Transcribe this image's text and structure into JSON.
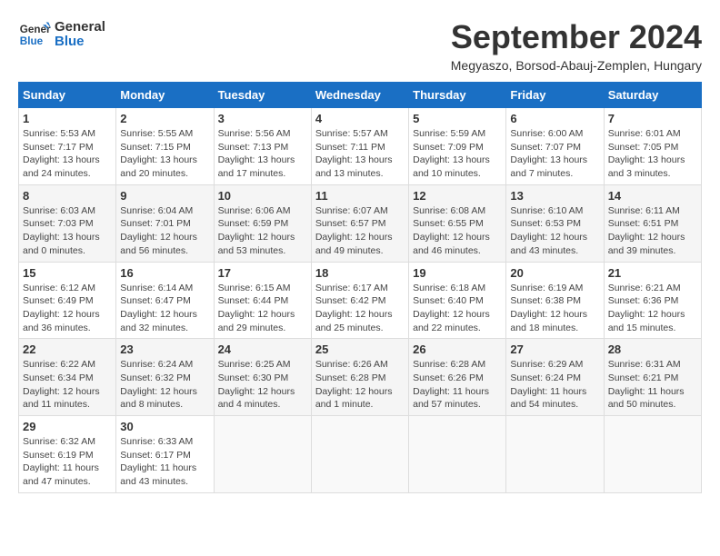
{
  "header": {
    "logo_line1": "General",
    "logo_line2": "Blue",
    "title": "September 2024",
    "location": "Megyaszo, Borsod-Abauj-Zemplen, Hungary"
  },
  "weekdays": [
    "Sunday",
    "Monday",
    "Tuesday",
    "Wednesday",
    "Thursday",
    "Friday",
    "Saturday"
  ],
  "weeks": [
    [
      {
        "day": "1",
        "content": "Sunrise: 5:53 AM\nSunset: 7:17 PM\nDaylight: 13 hours\nand 24 minutes."
      },
      {
        "day": "2",
        "content": "Sunrise: 5:55 AM\nSunset: 7:15 PM\nDaylight: 13 hours\nand 20 minutes."
      },
      {
        "day": "3",
        "content": "Sunrise: 5:56 AM\nSunset: 7:13 PM\nDaylight: 13 hours\nand 17 minutes."
      },
      {
        "day": "4",
        "content": "Sunrise: 5:57 AM\nSunset: 7:11 PM\nDaylight: 13 hours\nand 13 minutes."
      },
      {
        "day": "5",
        "content": "Sunrise: 5:59 AM\nSunset: 7:09 PM\nDaylight: 13 hours\nand 10 minutes."
      },
      {
        "day": "6",
        "content": "Sunrise: 6:00 AM\nSunset: 7:07 PM\nDaylight: 13 hours\nand 7 minutes."
      },
      {
        "day": "7",
        "content": "Sunrise: 6:01 AM\nSunset: 7:05 PM\nDaylight: 13 hours\nand 3 minutes."
      }
    ],
    [
      {
        "day": "8",
        "content": "Sunrise: 6:03 AM\nSunset: 7:03 PM\nDaylight: 13 hours\nand 0 minutes."
      },
      {
        "day": "9",
        "content": "Sunrise: 6:04 AM\nSunset: 7:01 PM\nDaylight: 12 hours\nand 56 minutes."
      },
      {
        "day": "10",
        "content": "Sunrise: 6:06 AM\nSunset: 6:59 PM\nDaylight: 12 hours\nand 53 minutes."
      },
      {
        "day": "11",
        "content": "Sunrise: 6:07 AM\nSunset: 6:57 PM\nDaylight: 12 hours\nand 49 minutes."
      },
      {
        "day": "12",
        "content": "Sunrise: 6:08 AM\nSunset: 6:55 PM\nDaylight: 12 hours\nand 46 minutes."
      },
      {
        "day": "13",
        "content": "Sunrise: 6:10 AM\nSunset: 6:53 PM\nDaylight: 12 hours\nand 43 minutes."
      },
      {
        "day": "14",
        "content": "Sunrise: 6:11 AM\nSunset: 6:51 PM\nDaylight: 12 hours\nand 39 minutes."
      }
    ],
    [
      {
        "day": "15",
        "content": "Sunrise: 6:12 AM\nSunset: 6:49 PM\nDaylight: 12 hours\nand 36 minutes."
      },
      {
        "day": "16",
        "content": "Sunrise: 6:14 AM\nSunset: 6:47 PM\nDaylight: 12 hours\nand 32 minutes."
      },
      {
        "day": "17",
        "content": "Sunrise: 6:15 AM\nSunset: 6:44 PM\nDaylight: 12 hours\nand 29 minutes."
      },
      {
        "day": "18",
        "content": "Sunrise: 6:17 AM\nSunset: 6:42 PM\nDaylight: 12 hours\nand 25 minutes."
      },
      {
        "day": "19",
        "content": "Sunrise: 6:18 AM\nSunset: 6:40 PM\nDaylight: 12 hours\nand 22 minutes."
      },
      {
        "day": "20",
        "content": "Sunrise: 6:19 AM\nSunset: 6:38 PM\nDaylight: 12 hours\nand 18 minutes."
      },
      {
        "day": "21",
        "content": "Sunrise: 6:21 AM\nSunset: 6:36 PM\nDaylight: 12 hours\nand 15 minutes."
      }
    ],
    [
      {
        "day": "22",
        "content": "Sunrise: 6:22 AM\nSunset: 6:34 PM\nDaylight: 12 hours\nand 11 minutes."
      },
      {
        "day": "23",
        "content": "Sunrise: 6:24 AM\nSunset: 6:32 PM\nDaylight: 12 hours\nand 8 minutes."
      },
      {
        "day": "24",
        "content": "Sunrise: 6:25 AM\nSunset: 6:30 PM\nDaylight: 12 hours\nand 4 minutes."
      },
      {
        "day": "25",
        "content": "Sunrise: 6:26 AM\nSunset: 6:28 PM\nDaylight: 12 hours\nand 1 minute."
      },
      {
        "day": "26",
        "content": "Sunrise: 6:28 AM\nSunset: 6:26 PM\nDaylight: 11 hours\nand 57 minutes."
      },
      {
        "day": "27",
        "content": "Sunrise: 6:29 AM\nSunset: 6:24 PM\nDaylight: 11 hours\nand 54 minutes."
      },
      {
        "day": "28",
        "content": "Sunrise: 6:31 AM\nSunset: 6:21 PM\nDaylight: 11 hours\nand 50 minutes."
      }
    ],
    [
      {
        "day": "29",
        "content": "Sunrise: 6:32 AM\nSunset: 6:19 PM\nDaylight: 11 hours\nand 47 minutes."
      },
      {
        "day": "30",
        "content": "Sunrise: 6:33 AM\nSunset: 6:17 PM\nDaylight: 11 hours\nand 43 minutes."
      },
      {
        "day": "",
        "content": ""
      },
      {
        "day": "",
        "content": ""
      },
      {
        "day": "",
        "content": ""
      },
      {
        "day": "",
        "content": ""
      },
      {
        "day": "",
        "content": ""
      }
    ]
  ]
}
